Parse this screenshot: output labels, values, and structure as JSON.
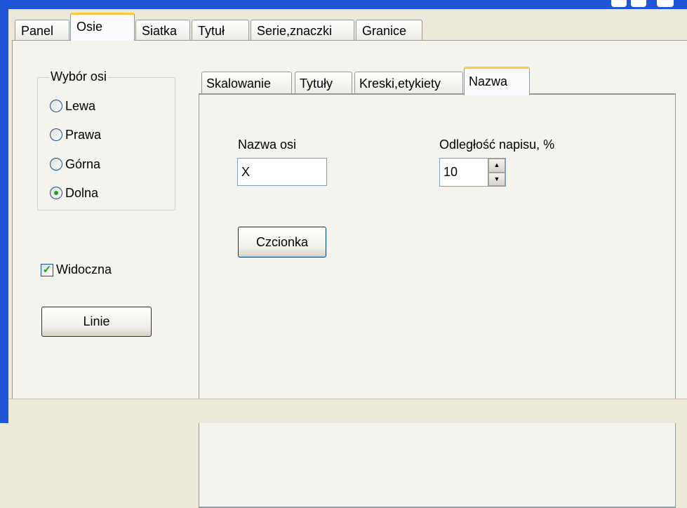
{
  "tabs": [
    {
      "label": "Panel"
    },
    {
      "label": "Osie"
    },
    {
      "label": "Siatka"
    },
    {
      "label": "Tytuł"
    },
    {
      "label": "Serie,znaczki"
    },
    {
      "label": "Granice"
    }
  ],
  "active_tab": "Osie",
  "axis_group": {
    "legend": "Wybór osi",
    "options": [
      {
        "label": "Lewa",
        "checked": false
      },
      {
        "label": "Prawa",
        "checked": false
      },
      {
        "label": "Górna",
        "checked": false
      },
      {
        "label": "Dolna",
        "checked": true
      }
    ]
  },
  "visible_checkbox": {
    "label": "Widoczna",
    "checked": true
  },
  "lines_button": {
    "label": "Linie"
  },
  "inner_tabs": [
    {
      "label": "Skalowanie"
    },
    {
      "label": "Tytuły"
    },
    {
      "label": "Kreski,etykiety"
    },
    {
      "label": "Nazwa"
    }
  ],
  "active_inner_tab": "Nazwa",
  "name_panel": {
    "axis_name_label": "Nazwa osi",
    "axis_name_value": "X",
    "distance_label": "Odległość napisu, %",
    "distance_value": "10",
    "font_button": "Czcionka"
  },
  "colors": {
    "titlebar": "#1F55D6",
    "tab_highlight": "#FFC83C",
    "check": "#21A121"
  },
  "icons": {
    "spin_up": "spin-up-arrow-icon",
    "spin_down": "spin-down-arrow-icon"
  }
}
